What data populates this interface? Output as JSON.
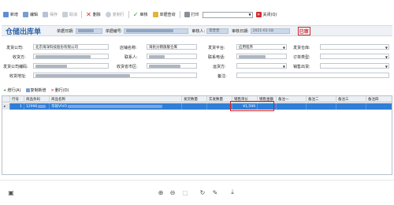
{
  "toolbar": {
    "new": "新增",
    "edit": "编辑",
    "save": "保存",
    "cancel": "取消",
    "delete": "删除",
    "copy": "复制行",
    "audit": "审核",
    "query": "单据查询",
    "print": "打印",
    "close": "关闭(Q)"
  },
  "header": {
    "title": "仓储出库单",
    "date_label": "单据日期:",
    "docno_label": "单据编号:",
    "auditor_label": "审核人:",
    "auditor_value": "李普普",
    "audit_date_label": "审核日期:",
    "audit_date_value": "2021-01-18",
    "stamp": "已审"
  },
  "form": {
    "shipper_label": "发货公司:",
    "shipper_value": "北京海洋科技股份有限公司",
    "store_label": "店铺名称:",
    "store_value": "海民分销旗舰仓库",
    "platform_label": "发货平台:",
    "platform_value": "应用程序",
    "warehouse_label": "发货仓库:",
    "receiver_label": "收货方:",
    "contact_label": "联系人:",
    "phone_label": "联系电话:",
    "ordertype_label": "订单类型:",
    "ship_company_label": "发货公司编码:",
    "recv_area_label": "收货省市区:",
    "ship_method_label": "运货方:",
    "sales_label": "销售出货:",
    "recv_addr_label": "收货地址:",
    "note_label": "备注:"
  },
  "subbar": {
    "add_row": "增行(A)",
    "copy_row": "复制新增",
    "del_row": "删行(D)"
  },
  "grid": {
    "headers": [
      "行号",
      "商品条码",
      "商品名称",
      "发货数量",
      "实发数量",
      "销售单价",
      "销售金额",
      "备注一",
      "备注二",
      "备注三",
      "备注四"
    ],
    "row": {
      "index": "1",
      "barcode": "12996",
      "name": "华硕VIVO",
      "price": "¥1,599"
    }
  }
}
